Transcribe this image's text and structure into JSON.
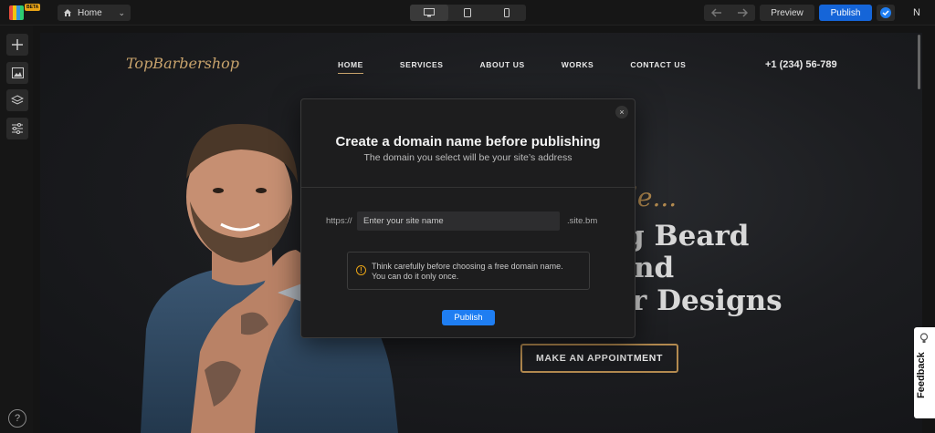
{
  "topbar": {
    "beta_badge": "BETA",
    "page_select": "Home",
    "preview_label": "Preview",
    "publish_label": "Publish",
    "avatar_initial": "N"
  },
  "site": {
    "logo": "TopBarbershop",
    "nav": [
      "HOME",
      "SERVICES",
      "ABOUT US",
      "WORKS",
      "CONTACT US"
    ],
    "active_nav": "HOME",
    "phone": "+1 (234) 56-789",
    "hero_script": "de...",
    "hero_lines": [
      "g Beard",
      "nd",
      "r Designs"
    ],
    "appointment_label": "MAKE AN APPOINTMENT"
  },
  "modal": {
    "title": "Create a domain name before publishing",
    "subtitle": "The domain you select will be your site’s address",
    "prefix": "https://",
    "input_placeholder": "Enter your site name",
    "input_value": "",
    "suffix": ".site.bm",
    "warning_line1": "Think carefully before choosing a free domain name.",
    "warning_line2": "You can do it only once.",
    "publish_label": "Publish",
    "close_label": "×"
  },
  "feedback": {
    "label": "Feedback"
  },
  "help": {
    "label": "?"
  },
  "colors": {
    "accent": "#1565d8",
    "gold": "#c8a36c",
    "warning": "#e8a316"
  }
}
